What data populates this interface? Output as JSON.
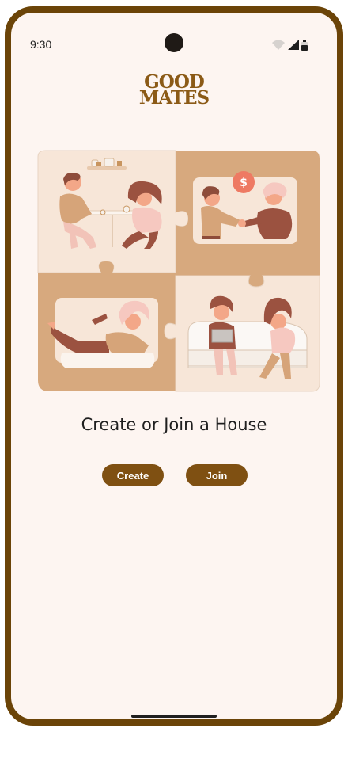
{
  "status_bar": {
    "time": "9:30",
    "icons": [
      "wifi-icon",
      "cellular-signal-icon",
      "battery-icon"
    ]
  },
  "app": {
    "logo_line_1": "GOOD",
    "logo_line_2": "MATES"
  },
  "main": {
    "headline": "Create or Join a House",
    "create_label": "Create",
    "join_label": "Join"
  },
  "colors": {
    "brand_brown": "#7f5012",
    "frame": "#6b4408",
    "background": "#fdf5f1",
    "puzzle_light": "#f7e6d8",
    "puzzle_dark": "#d7a97e"
  }
}
